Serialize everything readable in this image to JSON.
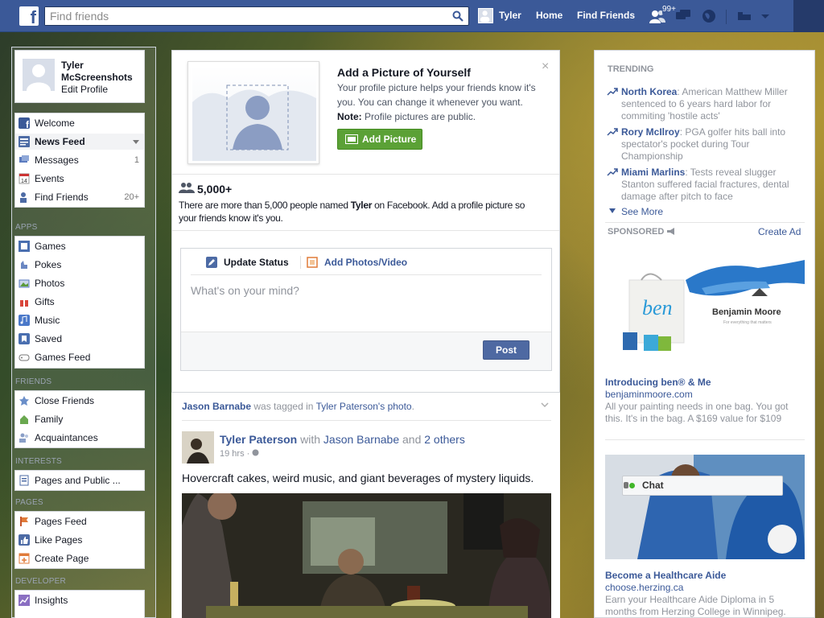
{
  "topbar": {
    "logo": "f",
    "search_placeholder": "Find friends",
    "user_name": "Tyler",
    "home_label": "Home",
    "find_friends_label": "Find Friends",
    "friend_requests_badge": "99+"
  },
  "profile": {
    "name": "Tyler McScreenshots",
    "edit_label": "Edit Profile"
  },
  "nav": {
    "favorites": [
      {
        "label": "Welcome",
        "icon": "facebook-icon"
      },
      {
        "label": "News Feed",
        "icon": "news-feed-icon"
      },
      {
        "label": "Messages",
        "icon": "messages-icon",
        "count": "1"
      },
      {
        "label": "Events",
        "icon": "calendar-icon"
      },
      {
        "label": "Find Friends",
        "icon": "find-friends-icon",
        "count": "20+"
      }
    ],
    "apps_heading": "APPS",
    "apps": [
      {
        "label": "Games",
        "icon": "games-icon"
      },
      {
        "label": "Pokes",
        "icon": "pokes-icon"
      },
      {
        "label": "Photos",
        "icon": "photos-icon"
      },
      {
        "label": "Gifts",
        "icon": "gifts-icon"
      },
      {
        "label": "Music",
        "icon": "music-icon"
      },
      {
        "label": "Saved",
        "icon": "saved-icon"
      },
      {
        "label": "Games Feed",
        "icon": "games-feed-icon"
      }
    ],
    "friends_heading": "FRIENDS",
    "friends": [
      {
        "label": "Close Friends",
        "icon": "close-friends-icon"
      },
      {
        "label": "Family",
        "icon": "family-icon"
      },
      {
        "label": "Acquaintances",
        "icon": "acquaintances-icon"
      }
    ],
    "interests_heading": "INTERESTS",
    "interests": [
      {
        "label": "Pages and Public ...",
        "icon": "pages-icon"
      }
    ],
    "pages_heading": "PAGES",
    "pages": [
      {
        "label": "Pages Feed",
        "icon": "pages-feed-icon"
      },
      {
        "label": "Like Pages",
        "icon": "like-icon"
      },
      {
        "label": "Create Page",
        "icon": "create-page-icon"
      }
    ],
    "developer_heading": "DEVELOPER",
    "developer": [
      {
        "label": "Insights",
        "icon": "insights-icon"
      }
    ]
  },
  "add_picture": {
    "title": "Add a Picture of Yourself",
    "body": "Your profile picture helps your friends know it's you. You can change it whenever you want.",
    "note_label": "Note:",
    "note_text": "Profile pictures are public.",
    "button_label": "Add Picture",
    "close": "×"
  },
  "people": {
    "count": "5,000+",
    "text_before": "There are more than 5,000 people named ",
    "name": "Tyler",
    "text_after": " on Facebook. Add a profile picture so your friends know it's you."
  },
  "composer": {
    "update_status": "Update Status",
    "add_photos": "Add Photos/Video",
    "placeholder": "What's on your mind?",
    "post_label": "Post"
  },
  "story": {
    "tagger": "Jason Barnabe",
    "tagged_text": " was tagged in ",
    "photo_owner": "Tyler Paterson's",
    "photo_word": " photo",
    "period": ".",
    "author": "Tyler Paterson",
    "with_text": " with ",
    "with_person": "Jason Barnabe",
    "and_text": " and ",
    "others": "2 others",
    "time": "19 hrs ·",
    "text": "Hovercraft cakes, weird music, and giant beverages of mystery liquids."
  },
  "trending": {
    "heading": "TRENDING",
    "items": [
      {
        "topic": "North Korea",
        "text": ": American Matthew Miller sentenced to 6 years hard labor for commiting 'hostile acts'"
      },
      {
        "topic": "Rory McIlroy",
        "text": ": PGA golfer hits ball into spectator's pocket during Tour Championship"
      },
      {
        "topic": "Miami Marlins",
        "text": ": Tests reveal slugger Stanton suffered facial fractures, dental damage after pitch to face"
      }
    ],
    "see_more": "See More"
  },
  "sponsored": {
    "heading": "SPONSORED",
    "create_ad": "Create Ad",
    "ads": [
      {
        "brand_logo_text": "Benjamin Moore",
        "tagline": "For everything that matters",
        "bag_text": "ben",
        "title": "Introducing ben® & Me",
        "url": "benjaminmoore.com",
        "desc": "All your painting needs in one bag. You got this. It's in the bag. A $169 value for $109"
      },
      {
        "title": "Become a Healthcare Aide",
        "url": "choose.herzing.ca",
        "desc": "Earn your Healthcare Aide Diploma in 5 months from Herzing College in Winnipeg."
      }
    ]
  },
  "chat": {
    "label": "Chat"
  },
  "colors": {
    "brand": "#3b5998",
    "green_button": "#5ba136",
    "post_button": "#4e69a2"
  }
}
